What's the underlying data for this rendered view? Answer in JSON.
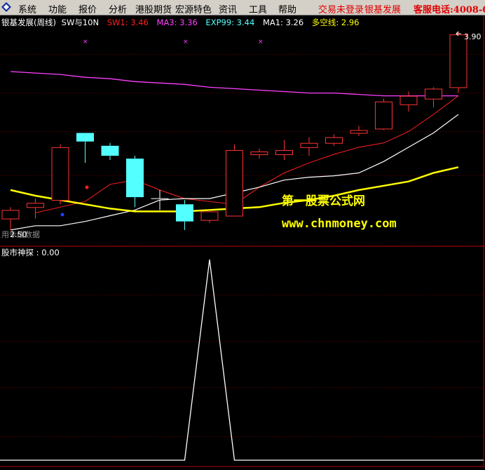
{
  "menu": {
    "items": [
      "系统",
      "功能",
      "报价",
      "分析",
      "港股期货",
      "宏源特色",
      "资讯",
      "工具",
      "帮助"
    ],
    "trade_status": "交易未登录",
    "broker": "银基发展",
    "hotline": "客服电话:4008-0"
  },
  "colors": {
    "background": "#000000",
    "grid": "#7a0000",
    "up_candle": "#ff3333",
    "down_candle": "#54ffff",
    "sw1": "#ff2020",
    "ma3": "#ff40ff",
    "exp99": "#54ffff",
    "ma1": "#ffffff",
    "duokong": "#ffff00",
    "watermark_title": "#ffff00",
    "watermark_url": "#ffff00"
  },
  "main_panel": {
    "title": "银基发展(周线)",
    "formula": "SW与10N",
    "indicators": [
      {
        "label": "SW1: ",
        "value": "3.46",
        "color": "#ff2020"
      },
      {
        "label": "MA3: ",
        "value": "3.36",
        "color": "#ff40ff"
      },
      {
        "label": "EXP99: ",
        "value": "3.44",
        "color": "#54ffff"
      },
      {
        "label": "MA1: ",
        "value": "3.26",
        "color": "#ffffff"
      },
      {
        "label": "多空线: ",
        "value": "2.96",
        "color": "#ffff00"
      }
    ],
    "high_label": "3.90",
    "low_label": "2.50",
    "left_note": "用卡线数据",
    "watermark_title": "第一股票公式网",
    "watermark_url": "www.chnmoney.com"
  },
  "sub_panel": {
    "title": "股市神探",
    "value": "0.00"
  },
  "chart_data": [
    {
      "type": "candlestick",
      "title": "银基发展(周线)",
      "price_range": [
        2.48,
        3.93
      ],
      "candles": [
        {
          "o": 2.6,
          "h": 2.68,
          "l": 2.52,
          "c": 2.66,
          "dir": "up"
        },
        {
          "o": 2.68,
          "h": 2.74,
          "l": 2.6,
          "c": 2.71,
          "dir": "up"
        },
        {
          "o": 2.73,
          "h": 3.12,
          "l": 2.7,
          "c": 3.1,
          "dir": "up"
        },
        {
          "o": 3.2,
          "h": 3.2,
          "l": 2.99,
          "c": 3.14,
          "dir": "down"
        },
        {
          "o": 3.11,
          "h": 3.13,
          "l": 3.01,
          "c": 3.04,
          "dir": "down"
        },
        {
          "o": 3.02,
          "h": 3.04,
          "l": 2.68,
          "c": 2.75,
          "dir": "down"
        },
        {
          "o": 2.74,
          "h": 2.8,
          "l": 2.66,
          "c": 2.73,
          "dir": "neutral"
        },
        {
          "o": 2.7,
          "h": 2.73,
          "l": 2.52,
          "c": 2.58,
          "dir": "down"
        },
        {
          "o": 2.59,
          "h": 2.66,
          "l": 2.57,
          "c": 2.65,
          "dir": "up"
        },
        {
          "o": 2.62,
          "h": 3.12,
          "l": 2.62,
          "c": 3.08,
          "dir": "up"
        },
        {
          "o": 3.05,
          "h": 3.09,
          "l": 3.02,
          "c": 3.07,
          "dir": "up"
        },
        {
          "o": 3.05,
          "h": 3.15,
          "l": 3.01,
          "c": 3.08,
          "dir": "up"
        },
        {
          "o": 3.1,
          "h": 3.17,
          "l": 3.04,
          "c": 3.13,
          "dir": "up"
        },
        {
          "o": 3.13,
          "h": 3.19,
          "l": 3.11,
          "c": 3.17,
          "dir": "up"
        },
        {
          "o": 3.2,
          "h": 3.25,
          "l": 3.18,
          "c": 3.22,
          "dir": "up"
        },
        {
          "o": 3.23,
          "h": 3.44,
          "l": 3.22,
          "c": 3.42,
          "dir": "up"
        },
        {
          "o": 3.4,
          "h": 3.49,
          "l": 3.35,
          "c": 3.46,
          "dir": "up"
        },
        {
          "o": 3.44,
          "h": 3.52,
          "l": 3.38,
          "c": 3.51,
          "dir": "up"
        },
        {
          "o": 3.52,
          "h": 3.91,
          "l": 3.48,
          "c": 3.89,
          "dir": "up"
        }
      ],
      "series": [
        {
          "name": "SW1",
          "values": [
            null,
            2.64,
            2.68,
            2.72,
            2.84,
            2.87,
            2.8,
            2.74,
            2.72,
            2.7,
            2.82,
            2.92,
            2.99,
            3.05,
            3.1,
            3.13,
            3.21,
            3.33,
            3.46
          ]
        },
        {
          "name": "MA3",
          "values": [
            3.63,
            3.62,
            3.61,
            3.59,
            3.58,
            3.56,
            3.55,
            3.54,
            3.52,
            3.51,
            3.5,
            3.49,
            3.48,
            3.48,
            3.47,
            3.46,
            3.46,
            3.46,
            3.46
          ]
        },
        {
          "name": "MA1",
          "values": [
            2.52,
            2.55,
            2.55,
            2.58,
            2.62,
            2.66,
            2.73,
            2.74,
            2.74,
            2.78,
            2.82,
            2.87,
            2.89,
            2.9,
            2.92,
            3.0,
            3.1,
            3.2,
            3.33
          ]
        },
        {
          "name": "多空线",
          "values": [
            2.8,
            2.76,
            2.73,
            2.7,
            2.67,
            2.65,
            2.65,
            2.65,
            2.66,
            2.67,
            2.68,
            2.71,
            2.73,
            2.76,
            2.8,
            2.83,
            2.86,
            2.92,
            2.96
          ]
        }
      ]
    },
    {
      "type": "line",
      "title": "股市神探",
      "ylim": [
        0,
        1
      ],
      "series": [
        {
          "name": "股市神探",
          "values": [
            0,
            0,
            0,
            0,
            0,
            0,
            0,
            0,
            1,
            0,
            0,
            0,
            0,
            0,
            0,
            0,
            0,
            0,
            0
          ]
        }
      ]
    }
  ]
}
